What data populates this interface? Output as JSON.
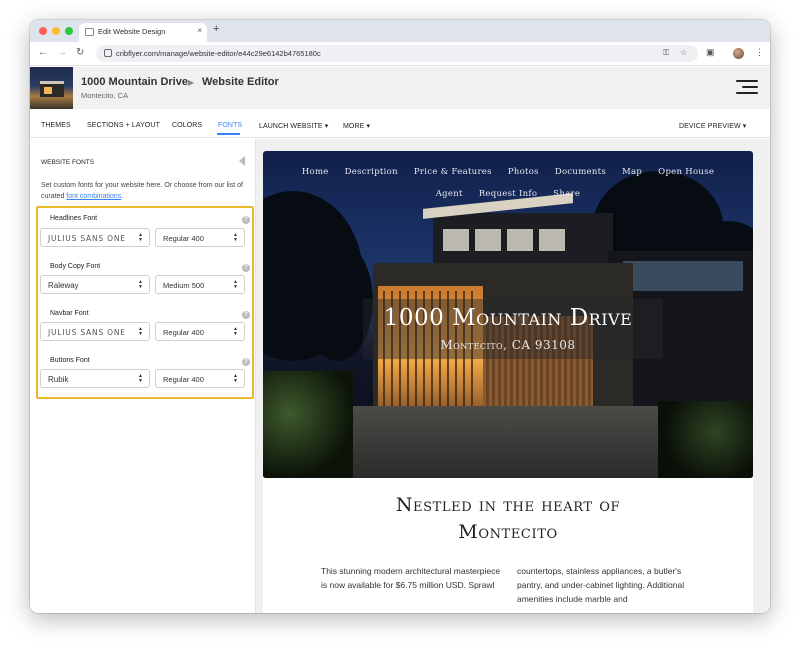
{
  "browser": {
    "tab_title": "Edit Website Design",
    "tab_close": "×",
    "new_tab": "+",
    "url": "cribflyer.com/manage/website-editor/e44c29e6142b4765180c"
  },
  "header": {
    "title": "1000 Mountain Drive",
    "separator": "▶",
    "editor_label": "Website Editor",
    "subtitle": "Montecito, CA"
  },
  "editor_nav": {
    "themes": "THEMES",
    "sections": "SECTIONS + LAYOUT",
    "colors": "COLORS",
    "fonts": "FONTS",
    "launch": "LAUNCH WEBSITE",
    "more": "MORE",
    "device_preview": "DEVICE PREVIEW",
    "caret": "▾"
  },
  "panel": {
    "title": "WEBSITE FONTS",
    "desc_prefix": "Set custom fonts for your website here. Or choose from our list of curated ",
    "desc_link": "font combinations",
    "desc_suffix": ".",
    "help": "?",
    "fonts": [
      {
        "label": "Headlines Font",
        "font": "JULIUS SANS ONE",
        "weight": "Regular 400"
      },
      {
        "label": "Body Copy Font",
        "font": "Raleway",
        "weight": "Medium 500"
      },
      {
        "label": "Navbar Font",
        "font": "JULIUS SANS ONE",
        "weight": "Regular 400"
      },
      {
        "label": "Buttons Font",
        "font": "Rubik",
        "weight": "Regular 400"
      }
    ]
  },
  "preview": {
    "nav_row1": [
      "Home",
      "Description",
      "Price & Features",
      "Photos",
      "Documents",
      "Map",
      "Open House"
    ],
    "nav_row2": [
      "Agent",
      "Request Info",
      "Share"
    ],
    "hero_title": "1000 Mountain Drive",
    "hero_subtitle": "Montecito, CA 93108",
    "heading_line1": "Nestled in the heart of",
    "heading_line2": "Montecito",
    "col1": "This stunning modern architectural masterpiece is now available for $6.75 million USD. Sprawl",
    "col2": "countertops, stainless appliances, a butler's pantry, and under-cabinet lighting. Additional amenities include marble and"
  },
  "colors": {
    "accent": "#3b82f6",
    "highlight_border": "#e8b92b"
  }
}
